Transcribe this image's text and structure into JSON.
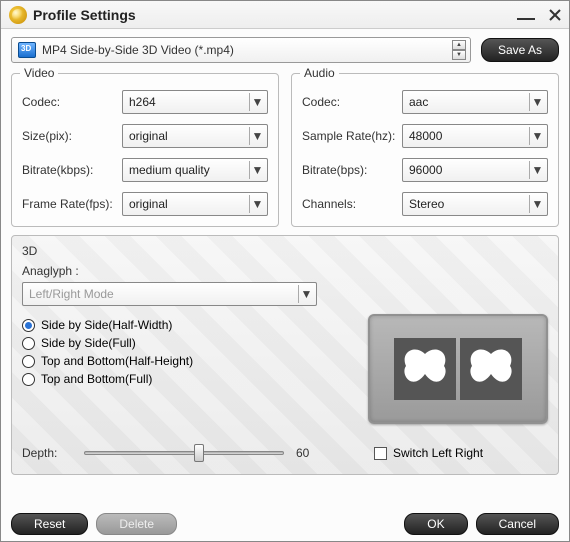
{
  "window": {
    "title": "Profile Settings"
  },
  "profile": {
    "selected": "MP4 Side-by-Side 3D Video (*.mp4)",
    "save_as": "Save As"
  },
  "video": {
    "legend": "Video",
    "codec_label": "Codec:",
    "codec_value": "h264",
    "size_label": "Size(pix):",
    "size_value": "original",
    "bitrate_label": "Bitrate(kbps):",
    "bitrate_value": "medium quality",
    "framerate_label": "Frame Rate(fps):",
    "framerate_value": "original"
  },
  "audio": {
    "legend": "Audio",
    "codec_label": "Codec:",
    "codec_value": "aac",
    "samplerate_label": "Sample Rate(hz):",
    "samplerate_value": "48000",
    "bitrate_label": "Bitrate(bps):",
    "bitrate_value": "96000",
    "channels_label": "Channels:",
    "channels_value": "Stereo"
  },
  "threed": {
    "legend": "3D",
    "anaglyph_label": "Anaglyph :",
    "anaglyph_value": "Left/Right Mode",
    "modes": [
      "Side by Side(Half-Width)",
      "Side by Side(Full)",
      "Top and Bottom(Half-Height)",
      "Top and Bottom(Full)"
    ],
    "selected_mode_index": 0,
    "depth_label": "Depth:",
    "depth_value": "60",
    "switch_label": "Switch Left Right",
    "switch_checked": false
  },
  "footer": {
    "reset": "Reset",
    "delete": "Delete",
    "ok": "OK",
    "cancel": "Cancel"
  }
}
